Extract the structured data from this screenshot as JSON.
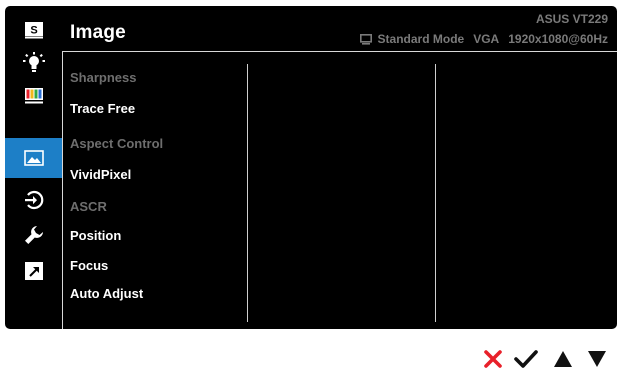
{
  "header": {
    "title": "Image",
    "model": "ASUS VT229",
    "mode": "Standard Mode",
    "input": "VGA",
    "resolution": "1920x1080@60Hz"
  },
  "sidebar": {
    "items": [
      {
        "icon": "splendid-s-icon",
        "active": false
      },
      {
        "icon": "brightness-bulb-icon",
        "active": false
      },
      {
        "icon": "color-bars-icon",
        "active": false
      },
      {
        "icon": "image-icon",
        "active": true
      },
      {
        "icon": "input-select-icon",
        "active": false
      },
      {
        "icon": "system-setup-wrench-icon",
        "active": false
      },
      {
        "icon": "shortcut-arrow-icon",
        "active": false
      }
    ]
  },
  "menu": {
    "items": [
      {
        "label": "Sharpness",
        "enabled": false
      },
      {
        "label": "Trace Free",
        "enabled": true
      },
      {
        "label": "Aspect Control",
        "enabled": false
      },
      {
        "label": "VividPixel",
        "enabled": true
      },
      {
        "label": "ASCR",
        "enabled": false
      },
      {
        "label": "Position",
        "enabled": true
      },
      {
        "label": "Focus",
        "enabled": true
      },
      {
        "label": "Auto Adjust",
        "enabled": true
      }
    ]
  },
  "nav": {
    "buttons": [
      "close-icon",
      "check-icon",
      "up-arrow-icon",
      "down-arrow-icon"
    ],
    "close_color": "#e8202a",
    "other_color": "#111111"
  },
  "colors": {
    "background": "#000000",
    "accent": "#1d7fc7",
    "text_enabled": "#ffffff",
    "text_disabled": "#6e6e6e"
  }
}
